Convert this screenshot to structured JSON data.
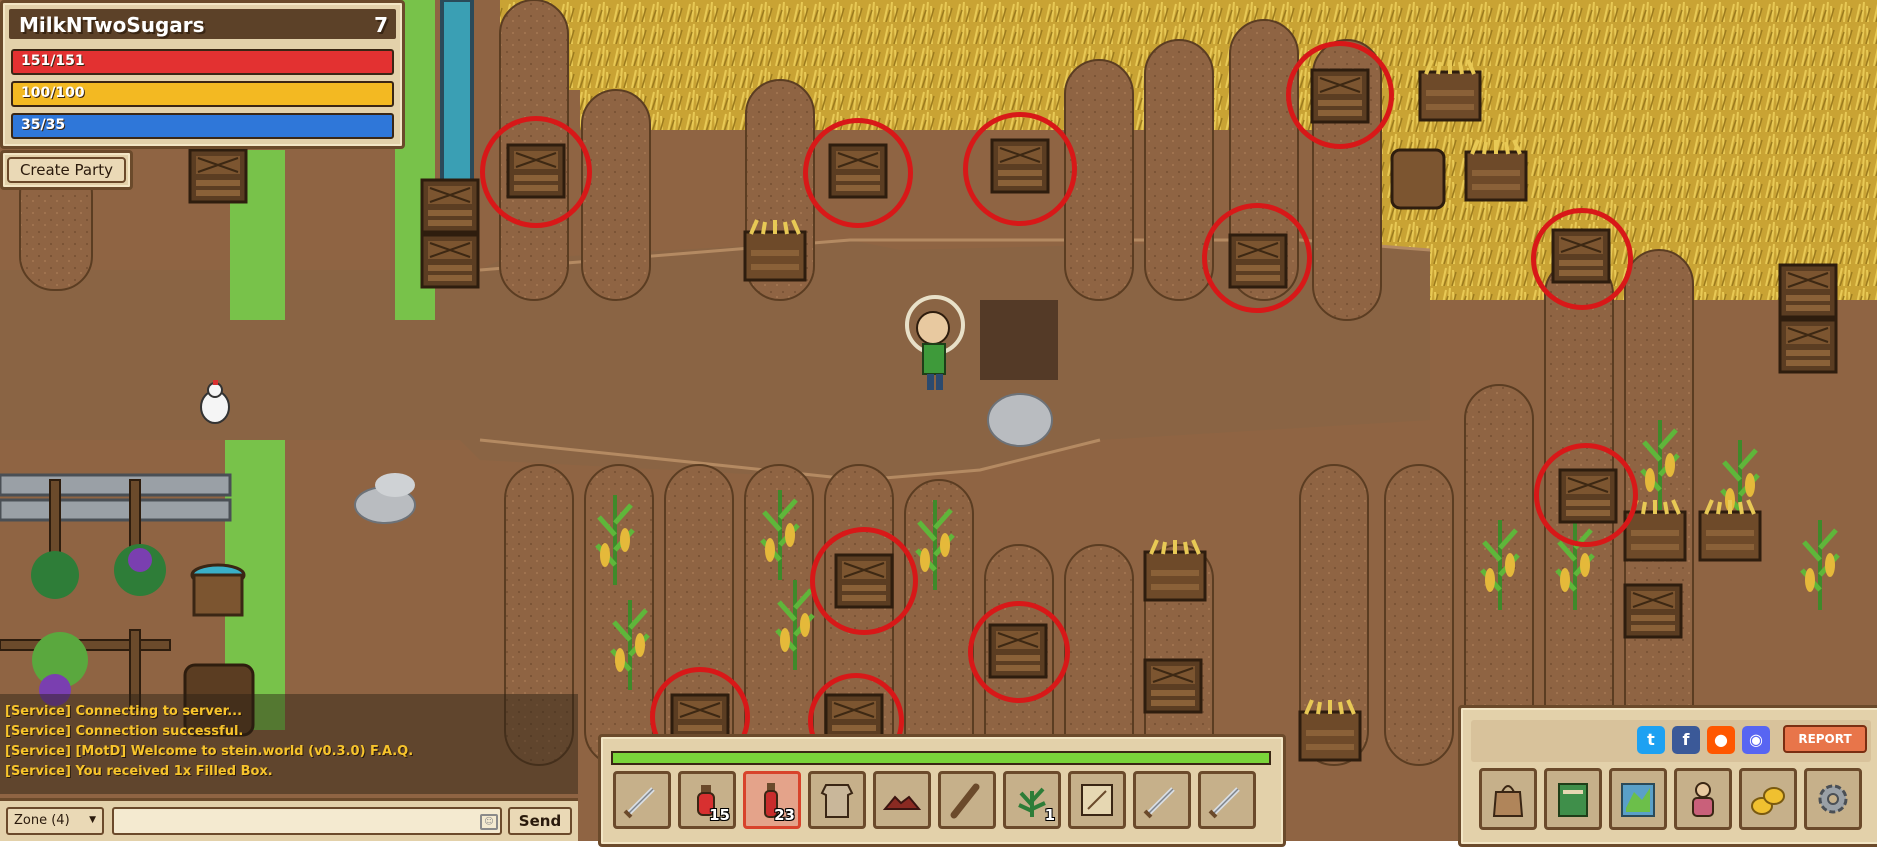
{
  "player": {
    "name": "MilkNTwoSugars",
    "level": "7",
    "hp": "151/151",
    "energy": "100/100",
    "mana": "35/35"
  },
  "party": {
    "create_label": "Create Party"
  },
  "chat": {
    "lines": [
      {
        "text": "[Service] Connecting to server..."
      },
      {
        "text": "[Service] Connection successful."
      },
      {
        "text": "[Service] [MotD] Welcome to stein.world (v0.3.0) F.A.Q."
      },
      {
        "text": "[Service] You received 1x Filled Box."
      }
    ],
    "zone": "Zone (4)",
    "send_label": "Send"
  },
  "hotbar": {
    "xp_fraction": 1.0,
    "slots": [
      {
        "icon": "sword-icon",
        "qty": ""
      },
      {
        "icon": "health-potion-icon",
        "qty": "15"
      },
      {
        "icon": "mana-potion-icon",
        "qty": "23",
        "selected": true
      },
      {
        "icon": "tunic-icon",
        "qty": ""
      },
      {
        "icon": "boots-icon",
        "qty": ""
      },
      {
        "icon": "club-icon",
        "qty": ""
      },
      {
        "icon": "herb-icon",
        "qty": "1"
      },
      {
        "icon": "map-scroll-icon",
        "qty": ""
      },
      {
        "icon": "sword-icon",
        "qty": ""
      },
      {
        "icon": "sword-icon",
        "qty": ""
      }
    ]
  },
  "menu": {
    "social": [
      "twitter-icon",
      "facebook-icon",
      "reddit-icon",
      "discord-icon"
    ],
    "report_label": "REPORT",
    "buttons": [
      "inventory-bag-icon",
      "quest-book-icon",
      "world-map-icon",
      "character-icon",
      "gold-coins-icon",
      "settings-gear-icon"
    ]
  },
  "colors": {
    "highlight_ring": "#d81818",
    "hp": "#e33131",
    "energy": "#f3b922",
    "mana": "#2f77d9",
    "xp": "#7ad43a"
  }
}
